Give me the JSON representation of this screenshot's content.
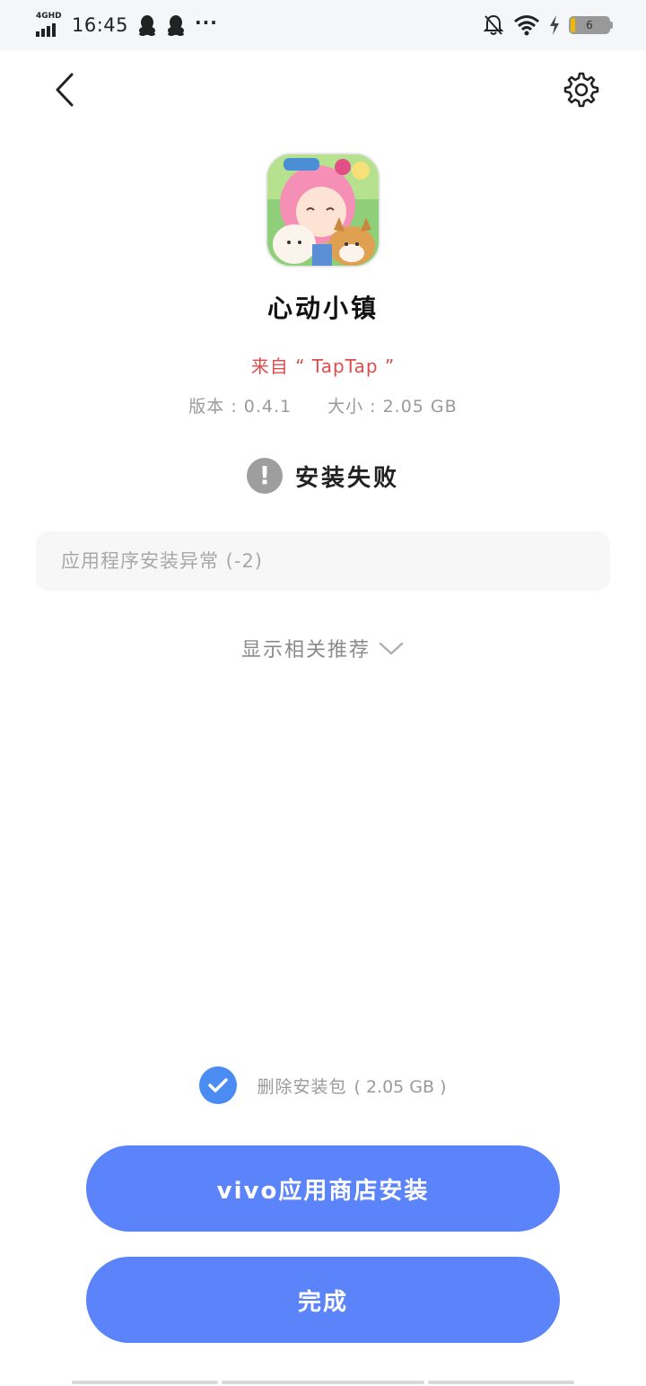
{
  "status_bar": {
    "network": "4GHD",
    "time": "16:45",
    "more": "···",
    "battery_level": "6",
    "icons": [
      "signal-icon",
      "qq-icon",
      "qq-icon",
      "more-icon",
      "bell-off-icon",
      "wifi-icon",
      "charging-icon",
      "battery-icon"
    ]
  },
  "header": {
    "back_icon": "back-arrow-icon",
    "settings_icon": "gear-icon"
  },
  "app": {
    "name": "心动小镇",
    "source": "来自 “ TapTap ”",
    "version": "版本 : 0.4.1",
    "size": "大小 : 2.05 GB"
  },
  "result": {
    "icon": "warning-icon",
    "status": "安装失败",
    "error_message": "应用程序安装异常 (-2)"
  },
  "recommend": {
    "label": "显示相关推荐"
  },
  "delete_package": {
    "checked": true,
    "label": "删除安装包",
    "size": "( 2.05 GB )"
  },
  "buttons": {
    "store_install": "vivo应用商店安装",
    "done": "完成"
  },
  "colors": {
    "accent": "#5b83fa",
    "checkbox": "#4a8cf1",
    "source_red": "#e04c4c",
    "status_bar_bg": "#f4f6f8"
  }
}
